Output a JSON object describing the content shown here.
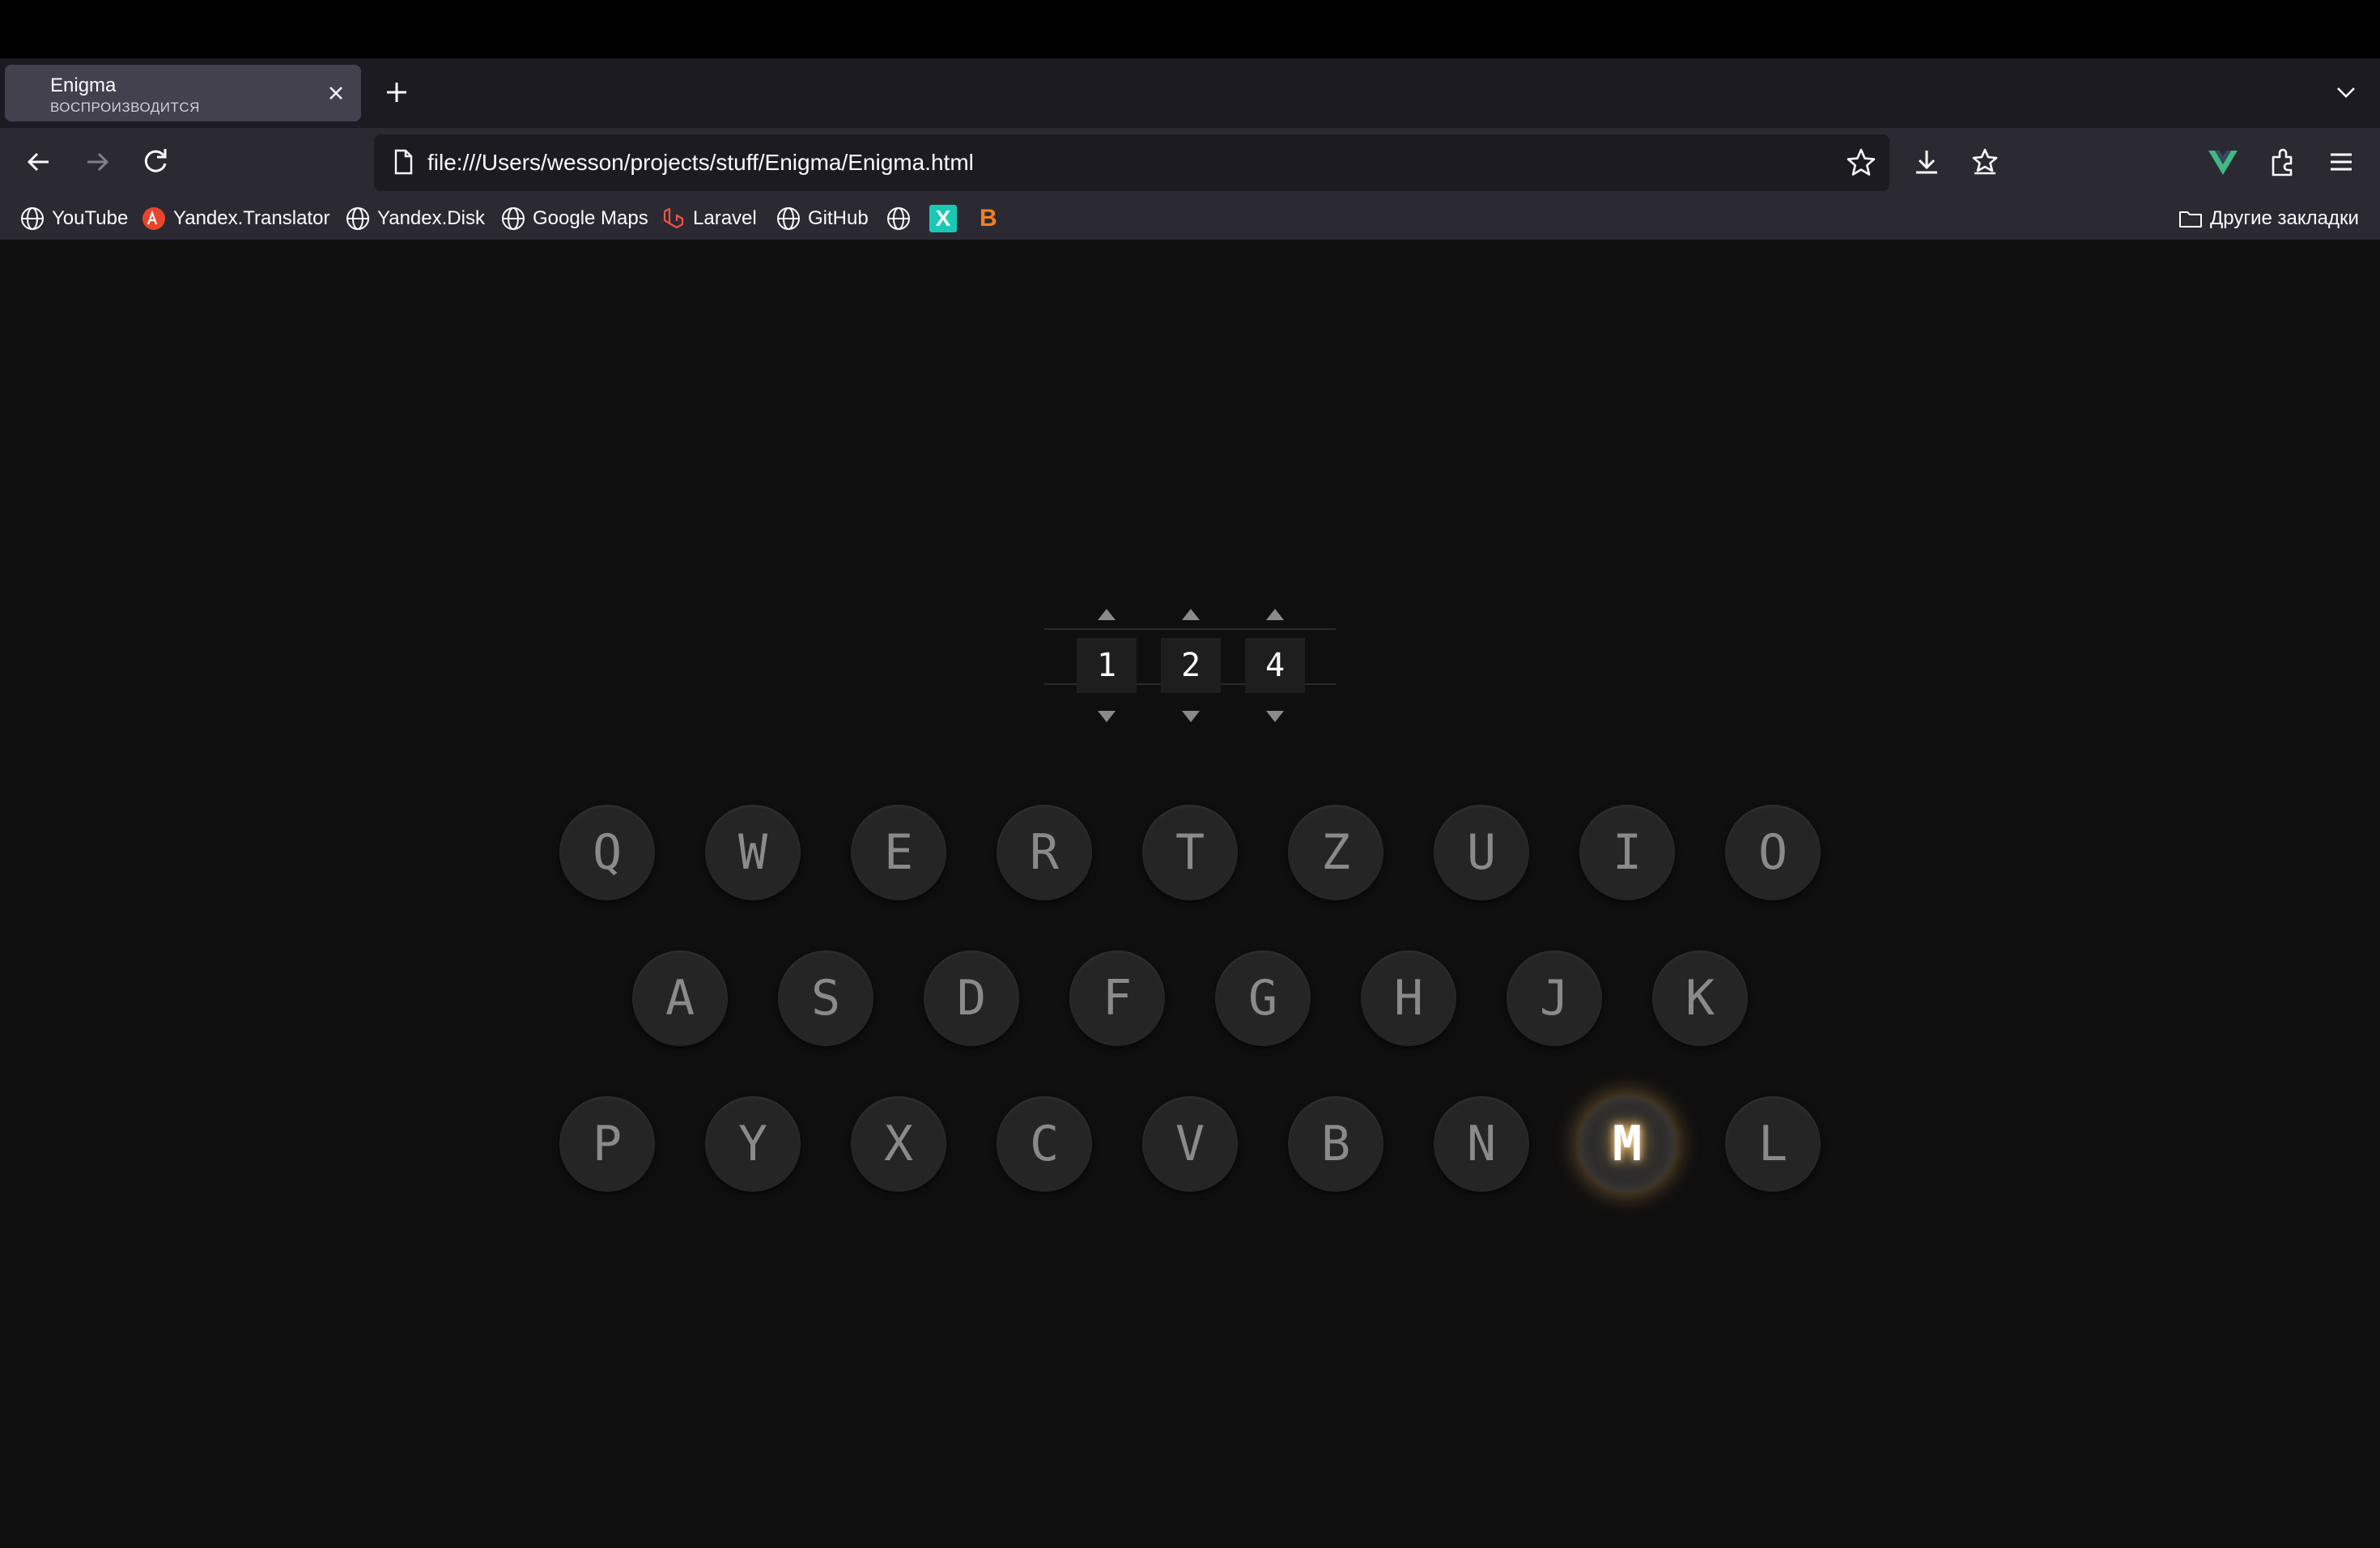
{
  "browser": {
    "tab": {
      "title": "Enigma",
      "status": "ВОСПРОИЗВОДИТСЯ"
    },
    "url": "file:///Users/wesson/projects/stuff/Enigma/Enigma.html",
    "bookmarks": [
      {
        "label": "YouTube"
      },
      {
        "label": "Yandex.Translator"
      },
      {
        "label": "Yandex.Disk"
      },
      {
        "label": "Google Maps"
      },
      {
        "label": "Laravel"
      },
      {
        "label": "GitHub"
      },
      {
        "label": ""
      },
      {
        "label": "X"
      },
      {
        "label": "B"
      }
    ],
    "other_bookmarks": "Другие закладки"
  },
  "enigma": {
    "rotors": [
      "1",
      "2",
      "4"
    ],
    "keyboard": {
      "row1": [
        "Q",
        "W",
        "E",
        "R",
        "T",
        "Z",
        "U",
        "I",
        "O"
      ],
      "row2": [
        "A",
        "S",
        "D",
        "F",
        "G",
        "H",
        "J",
        "K"
      ],
      "row3": [
        "P",
        "Y",
        "X",
        "C",
        "V",
        "B",
        "N",
        "M",
        "L"
      ]
    },
    "lit_key": "M"
  },
  "colors": {
    "vue_green": "#42b883",
    "translator_red": "#e8452c",
    "laravel_red": "#f05340",
    "x_teal": "#19c9b6",
    "b_orange": "#f38020",
    "glow": "#ffb64a"
  }
}
